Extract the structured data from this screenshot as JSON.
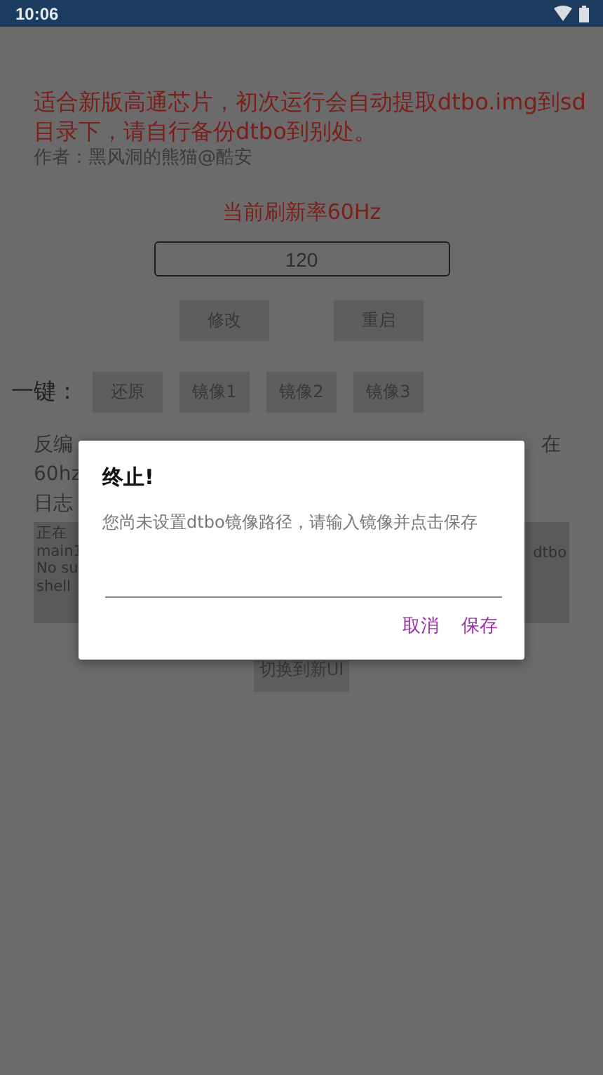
{
  "status_bar": {
    "time": "10:06"
  },
  "notice": "适合新版高通芯片，初次运行会自动提取dtbo.img到sd目录下，请自行备份dtbo到别处。",
  "author": "作者：黑风洞的熊猫@酷安",
  "refresh_rate": "当前刷新率60Hz",
  "rate_field": {
    "placeholder": "120"
  },
  "buttons": [
    "修改",
    "重启"
  ],
  "one_key": {
    "label": "一键：",
    "buttons": [
      "还原",
      "镜像1",
      "镜像2",
      "镜像3"
    ]
  },
  "behind_dialog": {
    "hint_left": "反编",
    "hint_right": "在",
    "hint_line2": "60hz",
    "log_label": "日志",
    "log_left": [
      "正在",
      "main1",
      "No su",
      "shell"
    ],
    "log_right": "dtbo"
  },
  "switch_button": "切换到新UI",
  "dialog": {
    "title": "终止!",
    "message": "您尚未设置dtbo镜像路径，请输入镜像并点击保存",
    "buttons": [
      "取消",
      "保存"
    ]
  }
}
